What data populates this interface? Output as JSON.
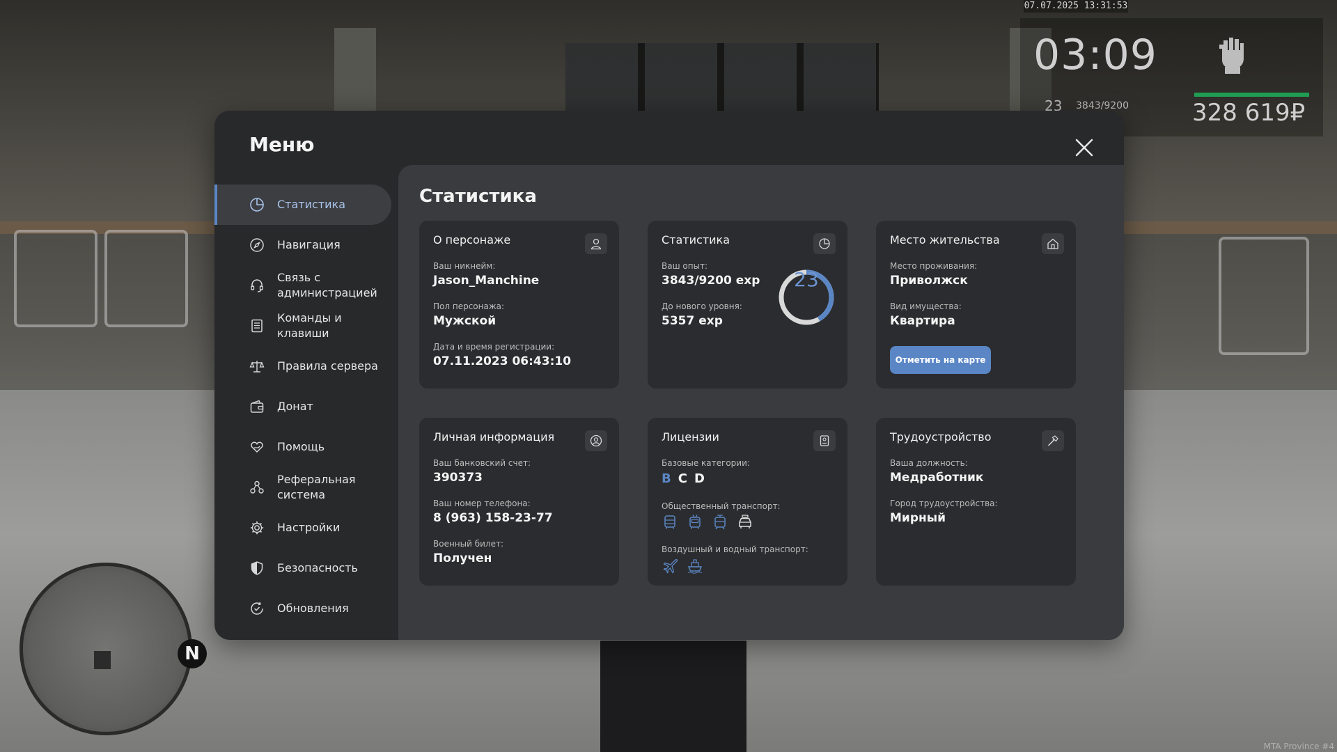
{
  "hud": {
    "datetime": "07.07.2025 13:31:53",
    "time": "03:09",
    "level": "23",
    "exp": "3843/9200",
    "money": "328 619₽",
    "compass": "N",
    "watermark": "MTA Province #4"
  },
  "menu": {
    "title": "Меню",
    "nav": [
      {
        "label": "Статистика",
        "icon": "chart-pie-icon",
        "active": true
      },
      {
        "label": "Навигация",
        "icon": "compass-icon"
      },
      {
        "label": "Связь с администрацией",
        "icon": "headset-icon"
      },
      {
        "label": "Команды и клавиши",
        "icon": "document-list-icon"
      },
      {
        "label": "Правила сервера",
        "icon": "scales-icon"
      },
      {
        "label": "Донат",
        "icon": "wallet-icon"
      },
      {
        "label": "Помощь",
        "icon": "heart-hand-icon"
      },
      {
        "label": "Реферальная система",
        "icon": "referral-icon"
      },
      {
        "label": "Настройки",
        "icon": "gear-icon"
      },
      {
        "label": "Безопасность",
        "icon": "shield-icon"
      },
      {
        "label": "Обновления",
        "icon": "refresh-check-icon"
      }
    ]
  },
  "stats": {
    "title": "Статистика",
    "character": {
      "title": "О персонаже",
      "nickname_label": "Ваш никнейм:",
      "nickname": "Jason_Manchine",
      "gender_label": "Пол персонажа:",
      "gender": "Мужской",
      "reg_label": "Дата и время регистрации:",
      "reg_date": "07.11.2023 06:43:10"
    },
    "statistics": {
      "title": "Статистика",
      "exp_label": "Ваш опыт:",
      "exp": "3843/9200 exp",
      "next_label": "До нового уровня:",
      "next": "5357 exp",
      "level": "23",
      "progress": 0.4177,
      "ring_color": "#5b86c4"
    },
    "residence": {
      "title": "Место жительства",
      "place_label": "Место проживания:",
      "place": "Приволжск",
      "property_label": "Вид имущества:",
      "property": "Квартира",
      "map_button": "Отметить на карте"
    },
    "personal": {
      "title": "Личная информация",
      "bank_label": "Ваш банковский счет:",
      "bank": "390373",
      "phone_label": "Ваш номер телефона:",
      "phone": "8 (963) 158-23-77",
      "military_label": "Военный билет:",
      "military": "Получен"
    },
    "licenses": {
      "title": "Лицензии",
      "base_label": "Базовые категории:",
      "categories": [
        "B",
        "C",
        "D"
      ],
      "public_label": "Общественный транспорт:",
      "public_icons": [
        "bus-icon",
        "trolleybus-icon",
        "tram-icon",
        "taxi-icon"
      ],
      "air_label": "Воздушный и водный транспорт:",
      "air_icons": [
        "airplane-icon",
        "ship-icon"
      ],
      "accent": "#5b86c4"
    },
    "employment": {
      "title": "Трудоустройство",
      "position_label": "Ваша должность:",
      "position": "Медработник",
      "city_label": "Город трудоустройства:",
      "city": "Мирный"
    }
  }
}
